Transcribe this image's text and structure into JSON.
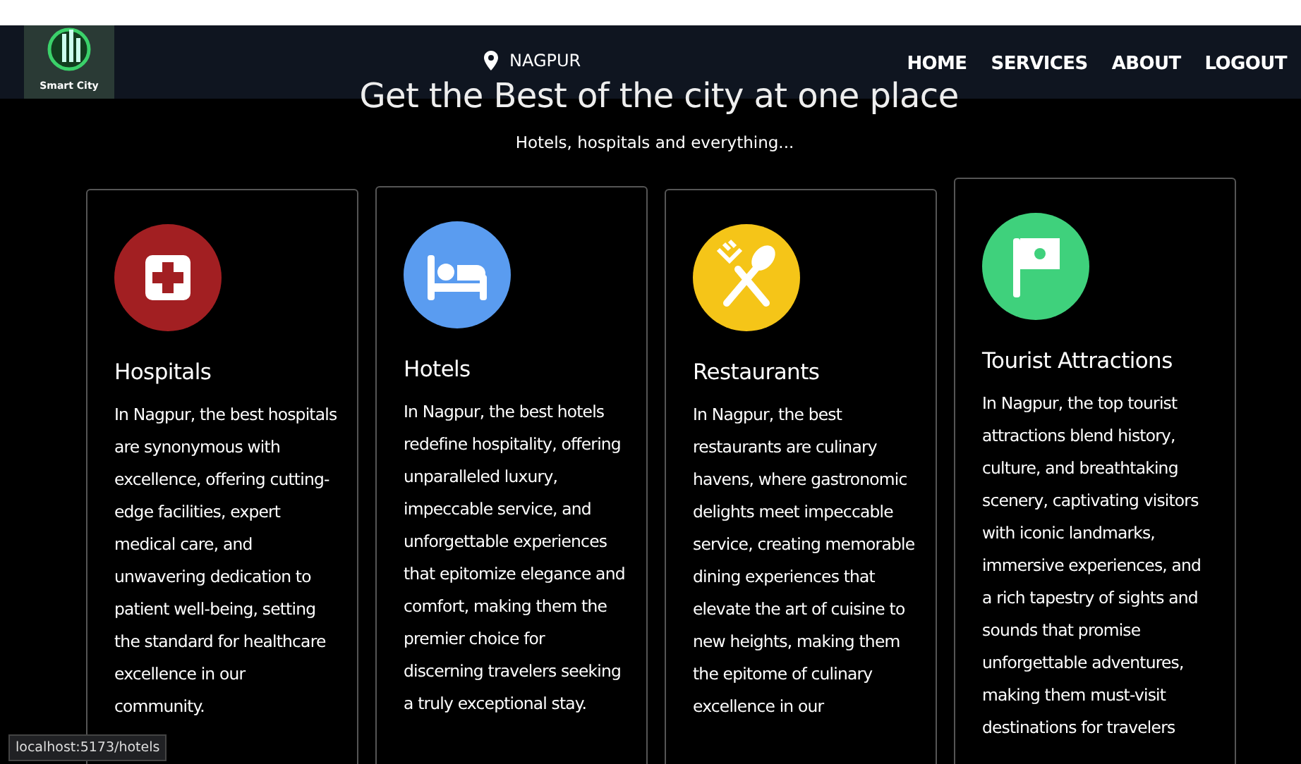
{
  "header": {
    "logo_text": "Smart City",
    "location": "NAGPUR",
    "nav": [
      {
        "label": "HOME"
      },
      {
        "label": "SERVICES"
      },
      {
        "label": "ABOUT"
      },
      {
        "label": "LOGOUT"
      }
    ]
  },
  "hero": {
    "title": "Get the Best of the city at one place",
    "subtitle": "Hotels, hospitals and everything..."
  },
  "cards": [
    {
      "kind": "hospital",
      "color": "#a21f22",
      "title": "Hospitals",
      "text": "In Nagpur, the best hospitals are synonymous with excellence, offering cutting-edge facilities, expert medical care, and unwavering dedication to patient well-being, setting the standard for healthcare excellence in our community."
    },
    {
      "kind": "hotel",
      "color": "#5a9cf0",
      "title": "Hotels",
      "text": "In Nagpur, the best hotels redefine hospitality, offering unparalleled luxury, impeccable service, and unforgettable experiences that epitomize elegance and comfort, making them the premier choice for discerning travelers seeking a truly exceptional stay."
    },
    {
      "kind": "restaurant",
      "color": "#f5c518",
      "title": "Restaurants",
      "text": "In Nagpur, the best restaurants are culinary havens, where gastronomic delights meet impeccable service, creating memorable dining experiences that elevate the art of cuisine to new heights, making them the epitome of culinary excellence in our"
    },
    {
      "kind": "attraction",
      "color": "#3fd17c",
      "title": "Tourist Attractions",
      "text": "In Nagpur, the top tourist attractions blend history, culture, and breathtaking scenery, captivating visitors with iconic landmarks, immersive experiences, and a rich tapestry of sights and sounds that promise unforgettable adventures, making them must-visit destinations for travelers"
    }
  ],
  "status_bar": {
    "url": "localhost:5173/hotels"
  }
}
